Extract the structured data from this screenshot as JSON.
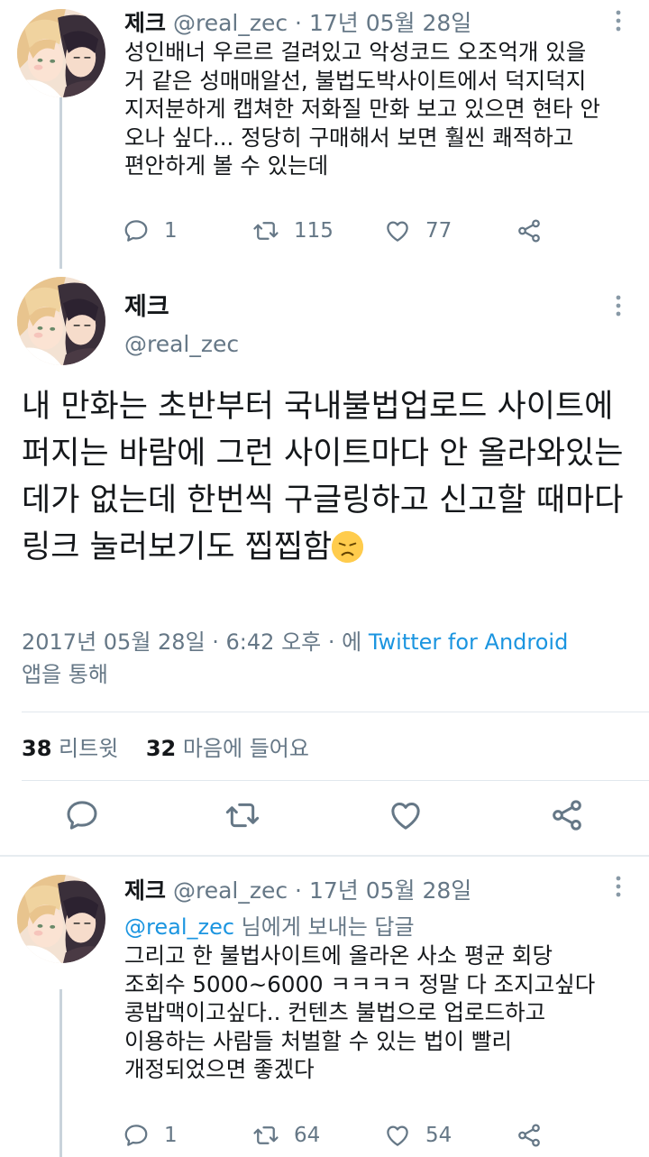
{
  "tweet1": {
    "name": "제크",
    "handle": "@real_zec",
    "sep": "·",
    "date": "17년 05월 28일",
    "text": "성인배너 우르르 걸려있고 악성코드 오조억개 있을\n거 같은 성매매알선, 불법도박사이트에서 덕지덕지\n지저분하게 캡쳐한 저화질 만화 보고 있으면 현타 안\n오나 싶다... 정당히 구매해서 보면 훨씬 쾌적하고\n편안하게 볼 수 있는데",
    "replies": "1",
    "retweets": "115",
    "likes": "77"
  },
  "main_tweet": {
    "name": "제크",
    "handle": "@real_zec",
    "text": "내 만화는 초반부터 국내불법업로드 사이트에 퍼지는 바람에 그런 사이트마다 안 올라와있는 데가 없는데 한번씩 구글링하고 신고할 때마다 링크 눌러보기도 찝찝함",
    "emoji": "disappointed-face",
    "meta_date": "2017년 05월 28일 · 6:42 오후 · 에 ",
    "meta_source": "Twitter for Android",
    "meta_suffix": "앱을 통해",
    "retweet_count": "38",
    "retweet_label": "리트윗",
    "like_count": "32",
    "like_label": "마음에 들어요"
  },
  "tweet3": {
    "name": "제크",
    "handle": "@real_zec",
    "sep": "·",
    "date": "17년 05월 28일",
    "reply_to_handle": "@real_zec",
    "reply_to_suffix": " 님에게 보내는 답글",
    "text": "그리고 한 불법사이트에 올라온 사소 평균 회당\n조회수 5000~6000 ㅋㅋㅋㅋ 정말 다 조지고싶다\n콩밥맥이고싶다.. 컨텐츠 불법으로 업로드하고\n이용하는 사람들 처벌할 수 있는 법이 빨리\n개정되었으면 좋겠다",
    "replies": "1",
    "retweets": "64",
    "likes": "54"
  },
  "icons": [
    "reply-icon",
    "retweet-icon",
    "like-icon",
    "share-icon",
    "more-options-icon",
    "avatar-image"
  ],
  "colors": {
    "link": "#1b95e0",
    "secondary": "#657786",
    "text": "#14171a",
    "thread": "#c9d3db"
  }
}
